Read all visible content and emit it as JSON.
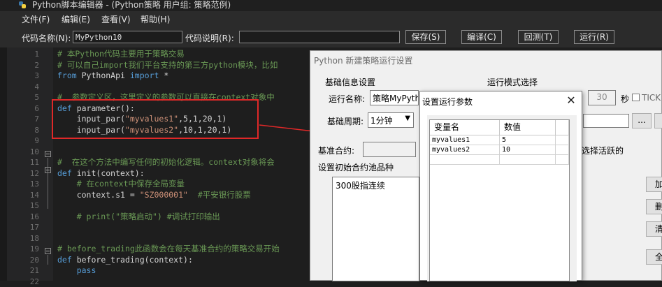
{
  "window": {
    "title": "Python脚本编辑器 - (Python策略 用户组: 策略范例)"
  },
  "menu": [
    "文件(F)",
    "编辑(E)",
    "查看(V)",
    "帮助(H)"
  ],
  "toolbar": {
    "name_label": "代码名称(N):",
    "name_value": "MyPython10",
    "desc_label": "代码说明(R):",
    "desc_value": "",
    "save": "保存(S)",
    "compile": "编译(C)",
    "test": "回测(T)",
    "run": "运行(R)"
  },
  "editor": {
    "line_numbers": [
      "1",
      "2",
      "3",
      "4",
      "5",
      "6",
      "7",
      "8",
      "9",
      "10",
      "11",
      "12",
      "13",
      "14",
      "15",
      "16",
      "17",
      "18",
      "19",
      "20",
      "21",
      "22"
    ],
    "lines": [
      [
        {
          "t": "# 本Python代码主要用于策略交易",
          "c": "cmt"
        }
      ],
      [
        {
          "t": "# 可以自己import我们平台支持的第三方python模块，比如",
          "c": "cmt"
        }
      ],
      [
        {
          "t": "from",
          "c": "kw"
        },
        {
          "t": " PythonApi ",
          "c": "txt"
        },
        {
          "t": "import",
          "c": "kw"
        },
        {
          "t": " *",
          "c": "txt"
        }
      ],
      [],
      [
        {
          "t": "#  参数定义区，这里定义的参数可以直接在context对象中",
          "c": "cmt"
        }
      ],
      [
        {
          "t": "def",
          "c": "kw"
        },
        {
          "t": " parameter():",
          "c": "txt"
        }
      ],
      [
        {
          "t": "    input_par(",
          "c": "txt"
        },
        {
          "t": "\"myvalues1\"",
          "c": "str"
        },
        {
          "t": ",5,1,20,1)",
          "c": "txt"
        }
      ],
      [
        {
          "t": "    input_par(",
          "c": "txt"
        },
        {
          "t": "\"myvalues2\"",
          "c": "str"
        },
        {
          "t": ",10,1,20,1)",
          "c": "txt"
        }
      ],
      [],
      [],
      [
        {
          "t": "#  在这个方法中编写任何的初始化逻辑。context对象将会",
          "c": "cmt"
        }
      ],
      [
        {
          "t": "def",
          "c": "kw"
        },
        {
          "t": " init(context):",
          "c": "txt"
        }
      ],
      [
        {
          "t": "    # 在context中保存全局变量",
          "c": "cmt"
        }
      ],
      [
        {
          "t": "    context.s1 = ",
          "c": "txt"
        },
        {
          "t": "\"SZ000001\"",
          "c": "str"
        },
        {
          "t": "  ",
          "c": "txt"
        },
        {
          "t": "#平安银行股票",
          "c": "cmt"
        }
      ],
      [],
      [
        {
          "t": "    # print(\"策略启动\") #调试打印输出",
          "c": "cmt"
        }
      ],
      [],
      [],
      [
        {
          "t": "# before_trading此函数会在每天基准合约的策略交易开始",
          "c": "cmt"
        }
      ],
      [
        {
          "t": "def",
          "c": "kw"
        },
        {
          "t": " before_trading(context):",
          "c": "txt"
        }
      ],
      [
        {
          "t": "    pass",
          "c": "kw"
        }
      ],
      []
    ]
  },
  "run_dialog": {
    "title": "Python 新建策略运行设置",
    "basic_section": "基础信息设置",
    "mode_section": "运行模式选择",
    "run_name_label": "运行名称:",
    "run_name_value": "策略MyPython",
    "period_label": "基础周期:",
    "period_value": "1分钟",
    "base_contract_label": "基准合约:",
    "interval_value": "30",
    "seconds_label": "秒",
    "tick_label": "TICK",
    "browse_button": "...",
    "active_hint": "选择活跃的",
    "pool_label": "设置初始合约池品种",
    "pool_item": "300股指连续",
    "side_buttons": [
      "加",
      "删",
      "清",
      "全"
    ]
  },
  "param_dialog": {
    "title": "设置运行参数",
    "close": "✕",
    "headers": [
      "变量名",
      "数值"
    ],
    "rows": [
      {
        "name": "myvalues1",
        "value": "5"
      },
      {
        "name": "myvalues2",
        "value": "10"
      }
    ]
  }
}
